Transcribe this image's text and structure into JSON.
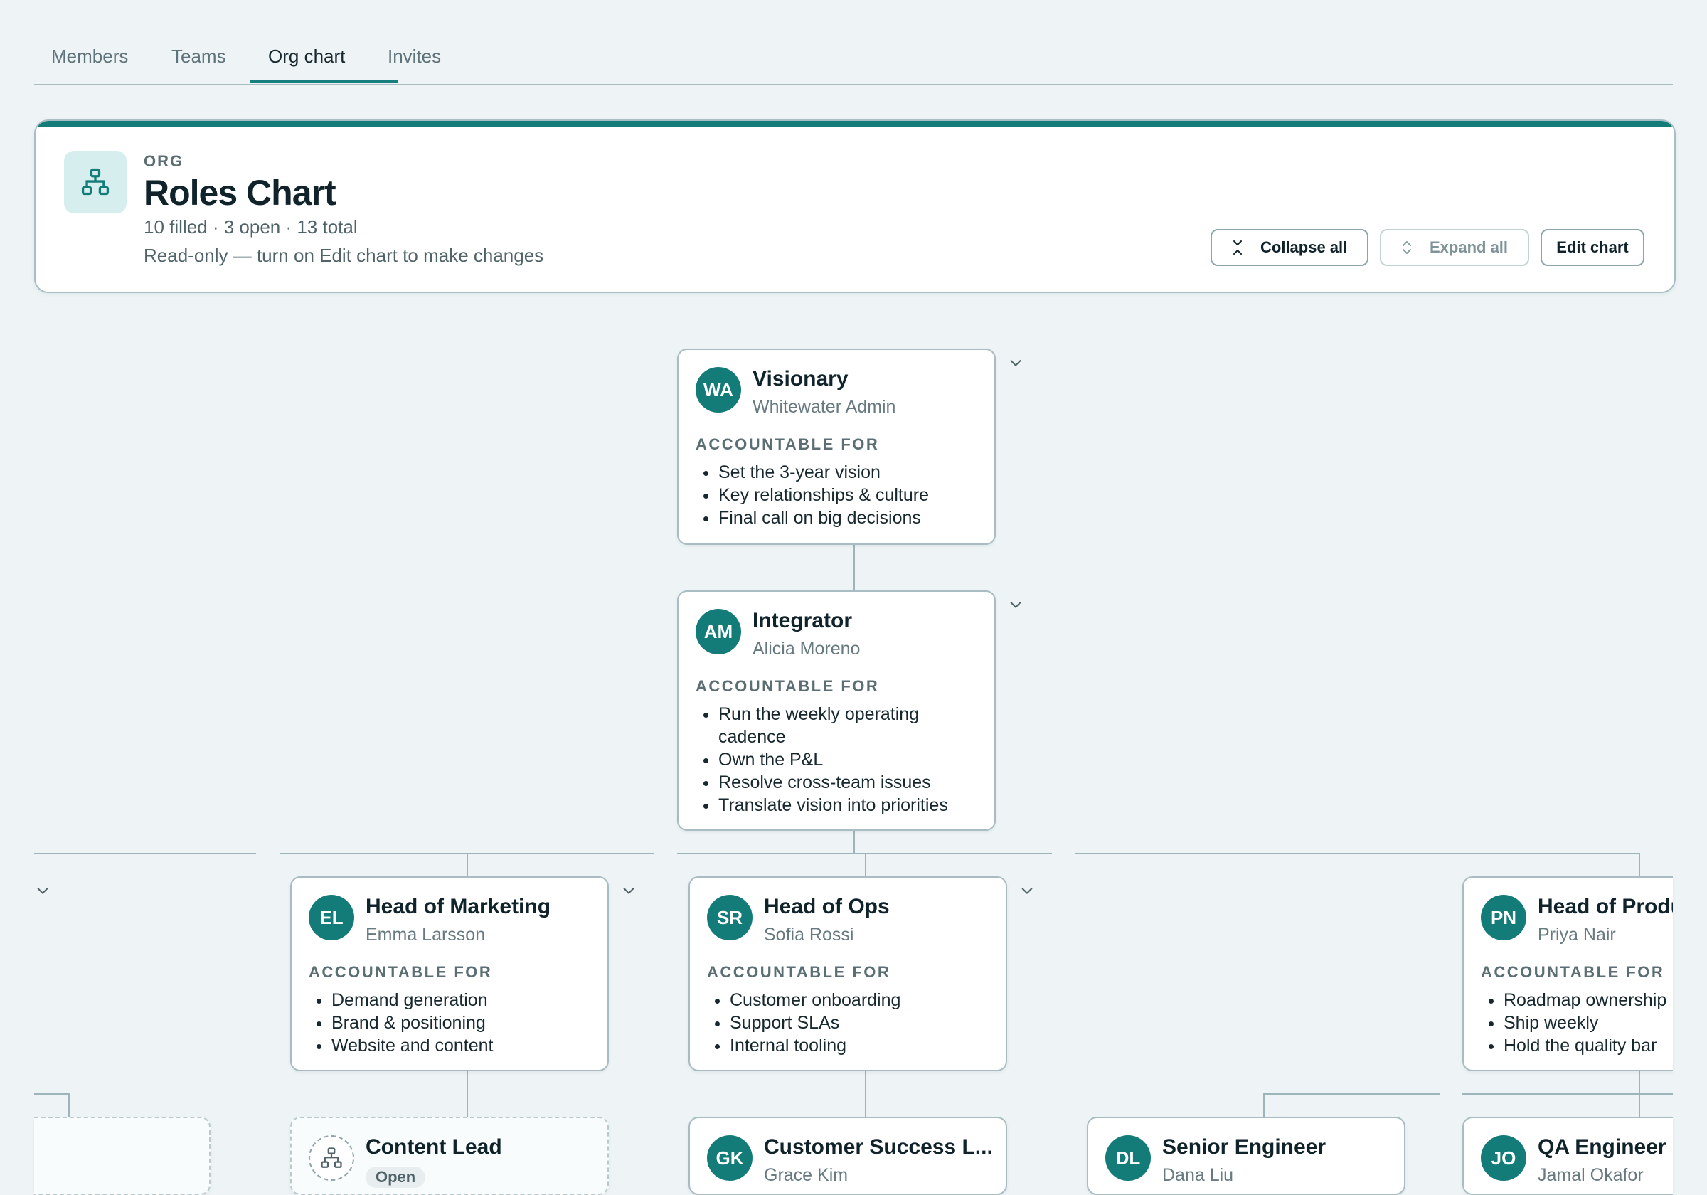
{
  "tabs": [
    {
      "label": "Members"
    },
    {
      "label": "Teams"
    },
    {
      "label": "Org chart"
    },
    {
      "label": "Invites"
    }
  ],
  "header": {
    "eyebrow": "ORG",
    "title": "Roles Chart",
    "stats": "10 filled · 3 open · 13 total",
    "readonly_note": "Read-only — turn on Edit chart to make changes",
    "collapse_label": "Collapse all",
    "expand_label": "Expand all",
    "edit_label": "Edit chart"
  },
  "accountable_label": "ACCOUNTABLE FOR",
  "nodes": {
    "visionary": {
      "initials": "WA",
      "role": "Visionary",
      "person": "Whitewater Admin",
      "items": [
        "Set the 3-year vision",
        "Key relationships & culture",
        "Final call on big decisions"
      ]
    },
    "integrator": {
      "initials": "AM",
      "role": "Integrator",
      "person": "Alicia Moreno",
      "items": [
        "Run the weekly operating cadence",
        "Own the P&L",
        "Resolve cross-team issues",
        "Translate vision into priorities"
      ]
    },
    "marketing": {
      "initials": "EL",
      "role": "Head of Marketing",
      "person": "Emma Larsson",
      "items": [
        "Demand generation",
        "Brand & positioning",
        "Website and content"
      ]
    },
    "ops": {
      "initials": "SR",
      "role": "Head of Ops",
      "person": "Sofia Rossi",
      "items": [
        "Customer onboarding",
        "Support SLAs",
        "Internal tooling"
      ]
    },
    "product": {
      "initials": "PN",
      "role": "Head of Produ",
      "person": "Priya Nair",
      "items": [
        "Roadmap ownership",
        "Ship weekly",
        "Hold the quality bar"
      ]
    },
    "content": {
      "role": "Content Lead",
      "badge": "Open"
    },
    "cs": {
      "initials": "GK",
      "role": "Customer Success L...",
      "person": "Grace Kim"
    },
    "senior_eng": {
      "initials": "DL",
      "role": "Senior Engineer",
      "person": "Dana Liu"
    },
    "qa": {
      "initials": "JO",
      "role": "QA Engineer",
      "person": "Jamal Okafor"
    }
  },
  "icons": {
    "tab_indicator_color": "#17807f",
    "accent_color": "#137c79",
    "avatar_color": "#137c79"
  }
}
